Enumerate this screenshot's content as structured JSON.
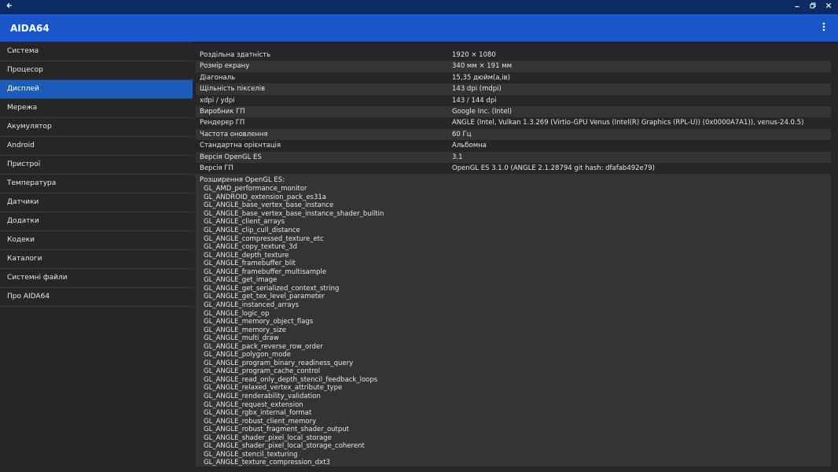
{
  "window": {
    "back_icon": "arrow-left-icon",
    "controls": [
      "minimize-icon",
      "restore-icon",
      "close-icon"
    ]
  },
  "appbar": {
    "title": "AIDA64"
  },
  "sidebar": {
    "items": [
      {
        "label": "Система"
      },
      {
        "label": "Процесор"
      },
      {
        "label": "Дисплей",
        "active": true
      },
      {
        "label": "Мережа"
      },
      {
        "label": "Акумулятор"
      },
      {
        "label": "Android"
      },
      {
        "label": "Пристрої"
      },
      {
        "label": "Температура"
      },
      {
        "label": "Датчики"
      },
      {
        "label": "Додатки"
      },
      {
        "label": "Кодеки"
      },
      {
        "label": "Каталоги"
      },
      {
        "label": "Системні файли"
      },
      {
        "label": "Про AIDA64"
      }
    ]
  },
  "display": {
    "properties": [
      {
        "key": "Роздільна здатність",
        "value": "1920 × 1080"
      },
      {
        "key": "Розмір екрану",
        "value": "340 мм × 191 мм"
      },
      {
        "key": "Діагональ",
        "value": "15,35 дюйм(а,ів)"
      },
      {
        "key": "Щільність пікселів",
        "value": "143 dpi (mdpi)"
      },
      {
        "key": "xdpi / ydpi",
        "value": "143 / 144 dpi"
      },
      {
        "key": "Виробник ГП",
        "value": "Google Inc. (Intel)"
      },
      {
        "key": "Рендерер ГП",
        "value": "ANGLE (Intel, Vulkan 1.3.269 (Virtio-GPU Venus (Intel(R) Graphics (RPL-U)) (0x0000A7A1)), venus-24.0.5)"
      },
      {
        "key": "Частота оновлення",
        "value": "60 Гц"
      },
      {
        "key": "Стандартна орієнтація",
        "value": "Альбомна"
      },
      {
        "key": "Версія OpenGL ES",
        "value": "3.1"
      },
      {
        "key": "Версія ГП",
        "value": "OpenGL ES 3.1.0 (ANGLE 2.1.28794 git hash: dfafab492e79)"
      }
    ],
    "extensions_title": "Розширення OpenGL ES:",
    "extensions": [
      "GL_AMD_performance_monitor",
      "GL_ANDROID_extension_pack_es31a",
      "GL_ANGLE_base_vertex_base_instance",
      "GL_ANGLE_base_vertex_base_instance_shader_builtin",
      "GL_ANGLE_client_arrays",
      "GL_ANGLE_clip_cull_distance",
      "GL_ANGLE_compressed_texture_etc",
      "GL_ANGLE_copy_texture_3d",
      "GL_ANGLE_depth_texture",
      "GL_ANGLE_framebuffer_blit",
      "GL_ANGLE_framebuffer_multisample",
      "GL_ANGLE_get_image",
      "GL_ANGLE_get_serialized_context_string",
      "GL_ANGLE_get_tex_level_parameter",
      "GL_ANGLE_instanced_arrays",
      "GL_ANGLE_logic_op",
      "GL_ANGLE_memory_object_flags",
      "GL_ANGLE_memory_size",
      "GL_ANGLE_multi_draw",
      "GL_ANGLE_pack_reverse_row_order",
      "GL_ANGLE_polygon_mode",
      "GL_ANGLE_program_binary_readiness_query",
      "GL_ANGLE_program_cache_control",
      "GL_ANGLE_read_only_depth_stencil_feedback_loops",
      "GL_ANGLE_relaxed_vertex_attribute_type",
      "GL_ANGLE_renderability_validation",
      "GL_ANGLE_request_extension",
      "GL_ANGLE_rgbx_internal_format",
      "GL_ANGLE_robust_client_memory",
      "GL_ANGLE_robust_fragment_shader_output",
      "GL_ANGLE_shader_pixel_local_storage",
      "GL_ANGLE_shader_pixel_local_storage_coherent",
      "GL_ANGLE_stencil_texturing",
      "GL_ANGLE_texture_compression_dxt3"
    ]
  },
  "colors": {
    "titlebar": "#0c2a63",
    "appbar": "#1a56c9",
    "active_item": "#1a5cb8",
    "background": "#262626",
    "row_alt": "#343434"
  }
}
